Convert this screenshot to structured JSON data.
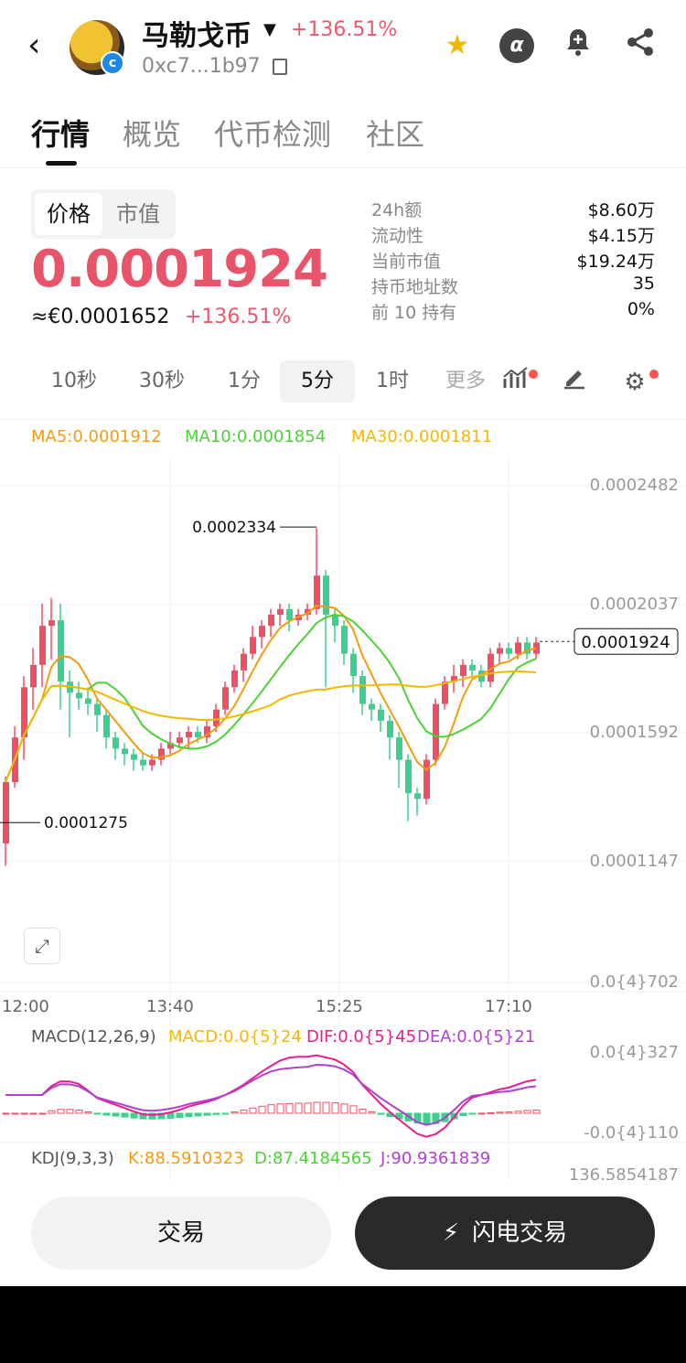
{
  "header": {
    "back_label": "‹",
    "token_name": "马勒戈币",
    "change": "+136.51%",
    "contract": "0xc7...1b97",
    "icons": [
      "back-icon",
      "star-icon",
      "alpha-icon",
      "bell-plus-icon",
      "share-icon",
      "copy-icon"
    ],
    "alpha_glyph": "α"
  },
  "tabs": [
    {
      "label": "行情",
      "active": true
    },
    {
      "label": "概览",
      "active": false
    },
    {
      "label": "代币检测",
      "active": false
    },
    {
      "label": "社区",
      "active": false
    }
  ],
  "price_toggle": {
    "price": "价格",
    "mcap": "市值"
  },
  "price": {
    "main": "0.0001924",
    "eur": "≈€0.0001652",
    "change": "+136.51%"
  },
  "stats": [
    {
      "label": "24h额",
      "value": "$8.60万"
    },
    {
      "label": "流动性",
      "value": "$4.15万"
    },
    {
      "label": "当前市值",
      "value": "$19.24万"
    },
    {
      "label": "持币地址数",
      "value": "35"
    },
    {
      "label": "前 10 持有",
      "value": "0%"
    }
  ],
  "intervals": [
    {
      "label": "10秒",
      "active": false
    },
    {
      "label": "30秒",
      "active": false
    },
    {
      "label": "1分",
      "active": false
    },
    {
      "label": "5分",
      "active": true
    },
    {
      "label": "1时",
      "active": false
    },
    {
      "label": "更多",
      "active": false
    }
  ],
  "ma_legend": {
    "ma5": "MA5:0.0001912",
    "ma10": "MA10:0.0001854",
    "ma30": "MA30:0.0001811"
  },
  "colors": {
    "up": "#ef4f64",
    "down": "#3ecf8e",
    "ma5": "#f39c12",
    "ma10": "#4cd137",
    "ma30": "#f5b800",
    "macd_dif": "#e91e8c",
    "macd_dea": "#b040d0"
  },
  "chart_data": {
    "type": "candlestick",
    "y_axis_labels": [
      "0.0002482",
      "0.0002037",
      "0.0001592",
      "0.0001147",
      "0.0{4}702"
    ],
    "x_axis_labels": [
      "12:00",
      "13:40",
      "15:25",
      "17:10"
    ],
    "annotations": {
      "high": "0.0002334",
      "low": "0.0001275",
      "current": "0.0001924"
    },
    "candles": [
      [
        0.00012,
        0.000142,
        0.000112,
        0.000144
      ],
      [
        0.000142,
        0.000158,
        0.00014,
        0.000162
      ],
      [
        0.000158,
        0.000176,
        0.00015,
        0.00018
      ],
      [
        0.000176,
        0.000184,
        0.000168,
        0.00019
      ],
      [
        0.000184,
        0.000198,
        0.000176,
        0.000206
      ],
      [
        0.000198,
        0.0002,
        0.000186,
        0.000208
      ],
      [
        0.0002,
        0.000178,
        0.000168,
        0.000206
      ],
      [
        0.000178,
        0.000174,
        0.000158,
        0.000182
      ],
      [
        0.000174,
        0.000172,
        0.000168,
        0.000178
      ],
      [
        0.000172,
        0.00017,
        0.000166,
        0.000176
      ],
      [
        0.00017,
        0.000166,
        0.00016,
        0.000172
      ],
      [
        0.000166,
        0.000158,
        0.000154,
        0.000168
      ],
      [
        0.000158,
        0.000154,
        0.00015,
        0.00016
      ],
      [
        0.000154,
        0.000152,
        0.000148,
        0.000156
      ],
      [
        0.000152,
        0.00015,
        0.000146,
        0.000154
      ],
      [
        0.00015,
        0.000148,
        0.000146,
        0.000152
      ],
      [
        0.000148,
        0.00015,
        0.000146,
        0.000152
      ],
      [
        0.00015,
        0.000154,
        0.000148,
        0.000156
      ],
      [
        0.000154,
        0.000156,
        0.000152,
        0.00016
      ],
      [
        0.000156,
        0.000158,
        0.000154,
        0.00016
      ],
      [
        0.000158,
        0.00016,
        0.000154,
        0.000162
      ],
      [
        0.00016,
        0.000158,
        0.000156,
        0.000162
      ],
      [
        0.000158,
        0.000162,
        0.000156,
        0.000164
      ],
      [
        0.000162,
        0.000168,
        0.00016,
        0.00017
      ],
      [
        0.000168,
        0.000176,
        0.000166,
        0.000178
      ],
      [
        0.000176,
        0.000182,
        0.000174,
        0.000184
      ],
      [
        0.000182,
        0.000188,
        0.000178,
        0.00019
      ],
      [
        0.000188,
        0.000194,
        0.000186,
        0.000198
      ],
      [
        0.000194,
        0.000198,
        0.00019,
        0.0002
      ],
      [
        0.000198,
        0.000202,
        0.000194,
        0.000204
      ],
      [
        0.000202,
        0.000204,
        0.000198,
        0.000206
      ],
      [
        0.000204,
        0.0002,
        0.000196,
        0.000206
      ],
      [
        0.0002,
        0.000202,
        0.000198,
        0.000204
      ],
      [
        0.000202,
        0.000204,
        0.0002,
        0.000206
      ],
      [
        0.000204,
        0.000216,
        0.000202,
        0.000233
      ],
      [
        0.000216,
        0.000202,
        0.000176,
        0.000218
      ],
      [
        0.000202,
        0.000198,
        0.000192,
        0.000204
      ],
      [
        0.000198,
        0.000188,
        0.000184,
        0.0002
      ],
      [
        0.000188,
        0.00018,
        0.000174,
        0.00019
      ],
      [
        0.00018,
        0.00017,
        0.000166,
        0.000182
      ],
      [
        0.00017,
        0.000168,
        0.000164,
        0.000172
      ],
      [
        0.000168,
        0.000164,
        0.00016,
        0.00017
      ],
      [
        0.000164,
        0.000158,
        0.00015,
        0.000166
      ],
      [
        0.000158,
        0.00015,
        0.00014,
        0.00016
      ],
      [
        0.00015,
        0.000138,
        0.000128,
        0.000152
      ],
      [
        0.000138,
        0.000136,
        0.00013,
        0.00014
      ],
      [
        0.000136,
        0.00015,
        0.000134,
        0.000152
      ],
      [
        0.00015,
        0.00017,
        0.000148,
        0.000172
      ],
      [
        0.00017,
        0.000178,
        0.000168,
        0.00018
      ],
      [
        0.000178,
        0.00018,
        0.000174,
        0.000184
      ],
      [
        0.00018,
        0.000184,
        0.000176,
        0.000186
      ],
      [
        0.000184,
        0.000182,
        0.00018,
        0.000186
      ],
      [
        0.000182,
        0.000178,
        0.000176,
        0.000184
      ],
      [
        0.000178,
        0.000188,
        0.000176,
        0.00019
      ],
      [
        0.000188,
        0.00019,
        0.000184,
        0.000192
      ],
      [
        0.00019,
        0.000188,
        0.000186,
        0.000192
      ],
      [
        0.000188,
        0.000192,
        0.000186,
        0.000194
      ],
      [
        0.000192,
        0.000188,
        0.000186,
        0.000194
      ],
      [
        0.000188,
        0.000192,
        0.000186,
        0.000194
      ]
    ]
  },
  "macd": {
    "title": "MACD(12,26,9)",
    "macd": "MACD:0.0{5}24",
    "dif": "DIF:0.0{5}45",
    "dea": "DEA:0.0{5}21",
    "axis_top": "0.0{4}327",
    "axis_bottom": "-0.0{4}110"
  },
  "kdj": {
    "title": "KDJ(9,3,3)",
    "k": "K:88.5910323",
    "d": "D:87.4184565",
    "j": "J:90.9361839",
    "axis_top": "136.5854187"
  },
  "buttons": {
    "trade": "交易",
    "flash": "闪电交易",
    "flash_icon": "⚡"
  }
}
